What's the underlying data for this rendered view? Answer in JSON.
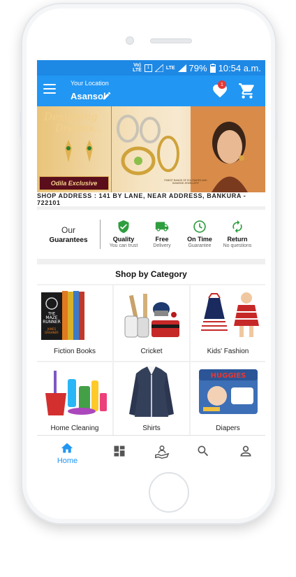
{
  "status_bar": {
    "volte_top": "Vo)",
    "volte_bottom": "LTE",
    "sim_label": "1",
    "lte_label": "LTE",
    "battery": "79%",
    "time": "10:54 a.m."
  },
  "header": {
    "location_label": "Your Location",
    "city": "Asansol",
    "wishlist_badge": "1",
    "accent_color": "#2196f3"
  },
  "banner": {
    "title_line1": "Designing",
    "title_line2": "Dreams...",
    "brand": "Odila Exclusive",
    "caption": "FINEST RANGE OF SOLITAIRES AND DIAMOND JEWELLERY"
  },
  "address_bar": "SHOP ADDRESS : 141 BY LANE, NEAR ADDRESS, BANKURA - 722101",
  "guarantees": {
    "our": "Our",
    "guarantees": "Guarantees",
    "items": [
      {
        "icon": "shield-check-icon",
        "title": "Quality",
        "subtitle": "You can trust"
      },
      {
        "icon": "truck-icon",
        "title": "Free",
        "subtitle": "Delivery"
      },
      {
        "icon": "clock-icon",
        "title": "On Time",
        "subtitle": "Guarantee"
      },
      {
        "icon": "refresh-icon",
        "title": "Return",
        "subtitle": "No questions"
      }
    ]
  },
  "category_section": {
    "title": "Shop by Category",
    "items": [
      {
        "label": "Fiction Books",
        "image": "book-set-image"
      },
      {
        "label": "Cricket",
        "image": "cricket-kit-image"
      },
      {
        "label": "Kids' Fashion",
        "image": "kids-dress-image"
      },
      {
        "label": "Home Cleaning",
        "image": "cleaning-supplies-image"
      },
      {
        "label": "Shirts",
        "image": "shirt-image"
      },
      {
        "label": "Diapers",
        "image": "diapers-pack-image"
      }
    ]
  },
  "book_cover": {
    "line1": "THE",
    "line2": "MAZE",
    "line3": "RUNNER",
    "author1": "JAMES",
    "author2": "DASHNER"
  },
  "diaper_brand": "HUGGIES",
  "bottom_nav": {
    "items": [
      {
        "label": "Home",
        "icon": "home-icon",
        "active": true
      },
      {
        "icon": "dashboard-icon"
      },
      {
        "icon": "hand-person-icon"
      },
      {
        "icon": "search-icon"
      },
      {
        "icon": "account-icon"
      }
    ]
  }
}
